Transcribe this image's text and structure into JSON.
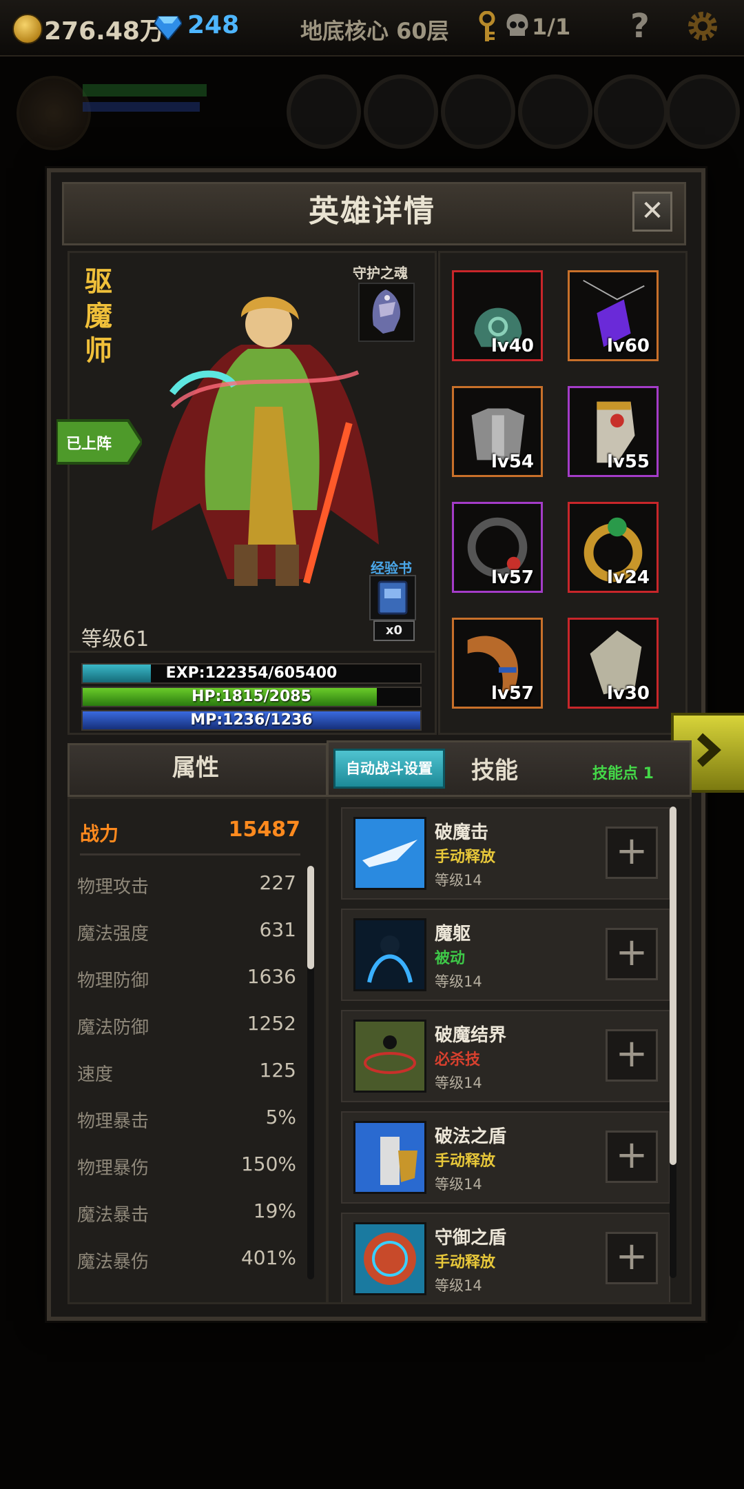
{
  "topbar": {
    "gold": "276.48万",
    "gems": "248",
    "location": "地底核心 60层",
    "skull_count": "1/1",
    "help": "?"
  },
  "dialog": {
    "title": "英雄详情",
    "close": "✕"
  },
  "hero": {
    "class_name": "驱魔师",
    "guardian_label": "守护之魂",
    "deployed_label": "已上阵",
    "exp_book_label": "经验书",
    "exp_book_count": "x0",
    "level_text": "等级61",
    "exp": {
      "text": "EXP:122354/605400",
      "current": 122354,
      "max": 605400
    },
    "hp": {
      "text": "HP:1815/2085",
      "current": 1815,
      "max": 2085
    },
    "mp": {
      "text": "MP:1236/1236",
      "current": 1236,
      "max": 1236
    }
  },
  "equipment": [
    {
      "level": "lv40",
      "icon": "helmet-icon",
      "rarity_color": "#c8262a"
    },
    {
      "level": "lv60",
      "icon": "crystal-amulet-icon",
      "rarity_color": "#c8702a"
    },
    {
      "level": "lv54",
      "icon": "chest-armor-icon",
      "rarity_color": "#c8702a"
    },
    {
      "level": "lv55",
      "icon": "gold-boots-icon",
      "rarity_color": "#a43cc8"
    },
    {
      "level": "lv57",
      "icon": "dark-ring-icon",
      "rarity_color": "#a43cc8"
    },
    {
      "level": "lv24",
      "icon": "gold-ring-icon",
      "rarity_color": "#c8262a"
    },
    {
      "level": "lv57",
      "icon": "horn-icon",
      "rarity_color": "#c8702a"
    },
    {
      "level": "lv30",
      "icon": "stone-shield-icon",
      "rarity_color": "#c8262a"
    }
  ],
  "attributes": {
    "header": "属性",
    "power_label": "战力",
    "power_value": "15487",
    "stats": [
      {
        "label": "物理攻击",
        "value": "227"
      },
      {
        "label": "魔法强度",
        "value": "631"
      },
      {
        "label": "物理防御",
        "value": "1636"
      },
      {
        "label": "魔法防御",
        "value": "1252"
      },
      {
        "label": "速度",
        "value": "125"
      },
      {
        "label": "物理暴击",
        "value": "5%"
      },
      {
        "label": "物理暴伤",
        "value": "150%"
      },
      {
        "label": "魔法暴击",
        "value": "19%"
      },
      {
        "label": "魔法暴伤",
        "value": "401%"
      }
    ]
  },
  "skills": {
    "auto_battle_button": "自动战斗设置",
    "header": "技能",
    "points": "技能点 1",
    "list": [
      {
        "name": "破魔击",
        "type": "手动释放",
        "type_color": "#e8c83a",
        "level": "等级14",
        "icon": "blade-strike-icon"
      },
      {
        "name": "魔躯",
        "type": "被动",
        "type_color": "#3ec848",
        "level": "等级14",
        "icon": "magic-body-icon"
      },
      {
        "name": "破魔结界",
        "type": "必杀技",
        "type_color": "#d8402e",
        "level": "等级14",
        "icon": "barrier-icon"
      },
      {
        "name": "破法之盾",
        "type": "手动释放",
        "type_color": "#e8c83a",
        "level": "等级14",
        "icon": "knight-shield-icon"
      },
      {
        "name": "守御之盾",
        "type": "手动释放",
        "type_color": "#e8c83a",
        "level": "等级14",
        "icon": "round-shield-icon"
      }
    ]
  }
}
